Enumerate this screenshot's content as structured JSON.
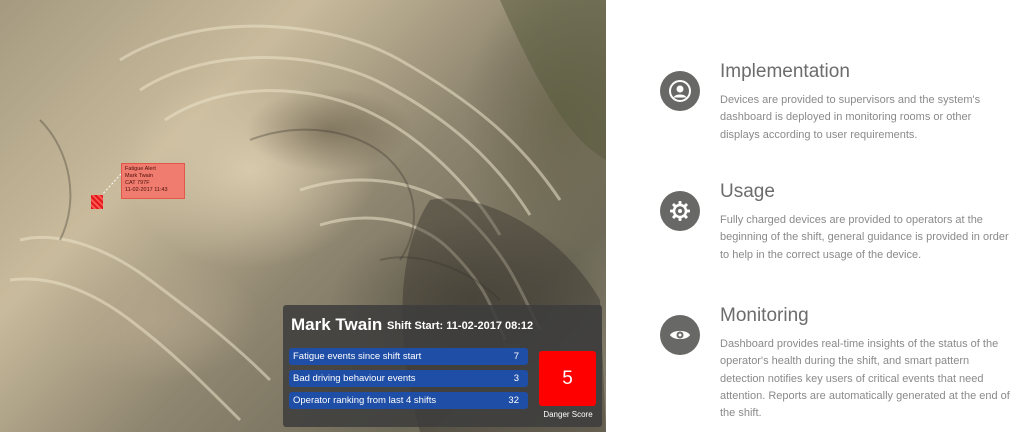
{
  "map": {
    "alert": {
      "lines": [
        "Fatigue Alert",
        "Mark Twain",
        "CAT 797F",
        "11-02-2017 11:43"
      ]
    },
    "operator_panel": {
      "name": "Mark Twain",
      "shift_start": "Shift Start: 11-02-2017 08:12",
      "stats": [
        {
          "label": "Fatigue events since shift start",
          "value": "7"
        },
        {
          "label": "Bad driving behaviour events",
          "value": "3"
        },
        {
          "label": "Operator ranking from last 4 shifts",
          "value": "32"
        }
      ],
      "danger_score": "5",
      "danger_label": "Danger Score",
      "colors": {
        "stat_bg": "#1f4ea6",
        "danger_bg": "#ff0000"
      }
    }
  },
  "features": [
    {
      "icon": "user-icon",
      "title": "Implementation",
      "description": "Devices are provided to supervisors and the system's dashboard is deployed in monitoring rooms or other displays according to user requirements."
    },
    {
      "icon": "gear-icon",
      "title": "Usage",
      "description": "Fully charged devices are provided to operators at the beginning of the shift, general guidance is provided in order to help in the correct usage of the device."
    },
    {
      "icon": "eye-icon",
      "title": "Monitoring",
      "description": "Dashboard provides real-time insights of the status of the operator's health during the shift, and smart pattern detection notifies key users of critical events that need attention. Reports are automatically generated at the end of the shift."
    }
  ]
}
